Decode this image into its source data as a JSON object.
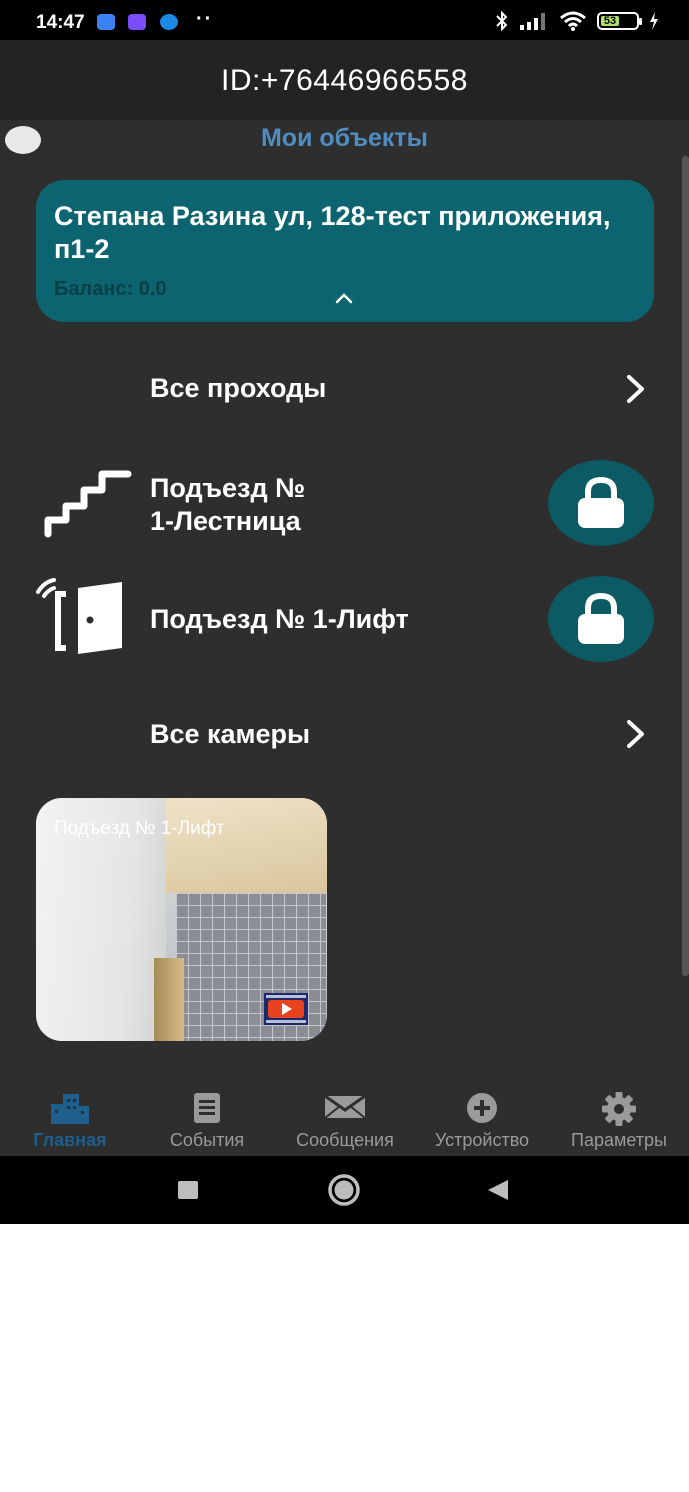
{
  "status_bar": {
    "time": "14:47",
    "battery": "53"
  },
  "header": {
    "title": "ID:+76446966558"
  },
  "section": {
    "title": "Мои объекты"
  },
  "object_card": {
    "name": "Степана Разина ул, 128-тест приложения, п1-2",
    "balance": "Баланс: 0.0"
  },
  "rows": {
    "all_passages": "Все проходы",
    "entrance_stairs": "Подъезд №\n1-Лестница",
    "entrance_lift": "Подъезд № 1-Лифт",
    "all_cameras": "Все камеры"
  },
  "camera": {
    "title": "Подъезд № 1-Лифт"
  },
  "bottom_nav": [
    {
      "label": "Главная",
      "icon": "home-buildings-icon",
      "active": true
    },
    {
      "label": "События",
      "icon": "events-list-icon",
      "active": false
    },
    {
      "label": "Сообщения",
      "icon": "envelope-icon",
      "active": false
    },
    {
      "label": "Устройство",
      "icon": "plus-circle-icon",
      "active": false
    },
    {
      "label": "Параметры",
      "icon": "gear-icon",
      "active": false
    }
  ],
  "colors": {
    "accent": "#0c6470",
    "section_title": "#4f8cc0",
    "nav_active": "#1e5f8c",
    "background": "#2e2e2e"
  }
}
